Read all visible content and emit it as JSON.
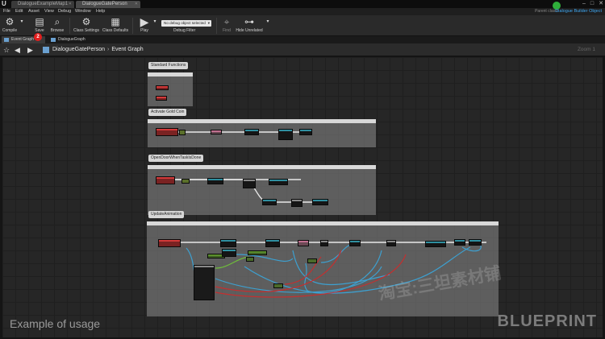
{
  "window": {
    "tabs": [
      {
        "label": "DialogueExampleMap1",
        "active": false
      },
      {
        "label": "DialogueGatePerson",
        "active": true
      }
    ]
  },
  "menu": {
    "items": [
      "File",
      "Edit",
      "Asset",
      "View",
      "Debug",
      "Window",
      "Help"
    ],
    "parent_class_label": "Parent class:",
    "parent_class_value": "Dialogue Builder Object"
  },
  "toolbar": {
    "compile": "Compile",
    "save": "Save",
    "browse": "Browse",
    "class_settings": "Class Settings",
    "class_defaults": "Class Defaults",
    "play": "Play",
    "debug_selected": "No debug object selected",
    "debug_filter": "Debug Filter",
    "find": "Find",
    "hide_unrelated": "Hide Unrelated",
    "badge_number": "2"
  },
  "graph_tabs": [
    "Event Graph",
    "DialogueGraph"
  ],
  "breadcrumb": {
    "asset": "DialogueGatePerson",
    "graph": "Event Graph",
    "zoom": "Zoom 1"
  },
  "comments": [
    "Standard Functions",
    "Activate Gold Coin",
    "OpenDoorWhenTaskIsDone",
    "UpdateAnimation"
  ],
  "overlay": {
    "caption": "Example of usage",
    "blueprint": "BLUEPRINT",
    "watermark": "淘宝:三坦素材铺"
  }
}
